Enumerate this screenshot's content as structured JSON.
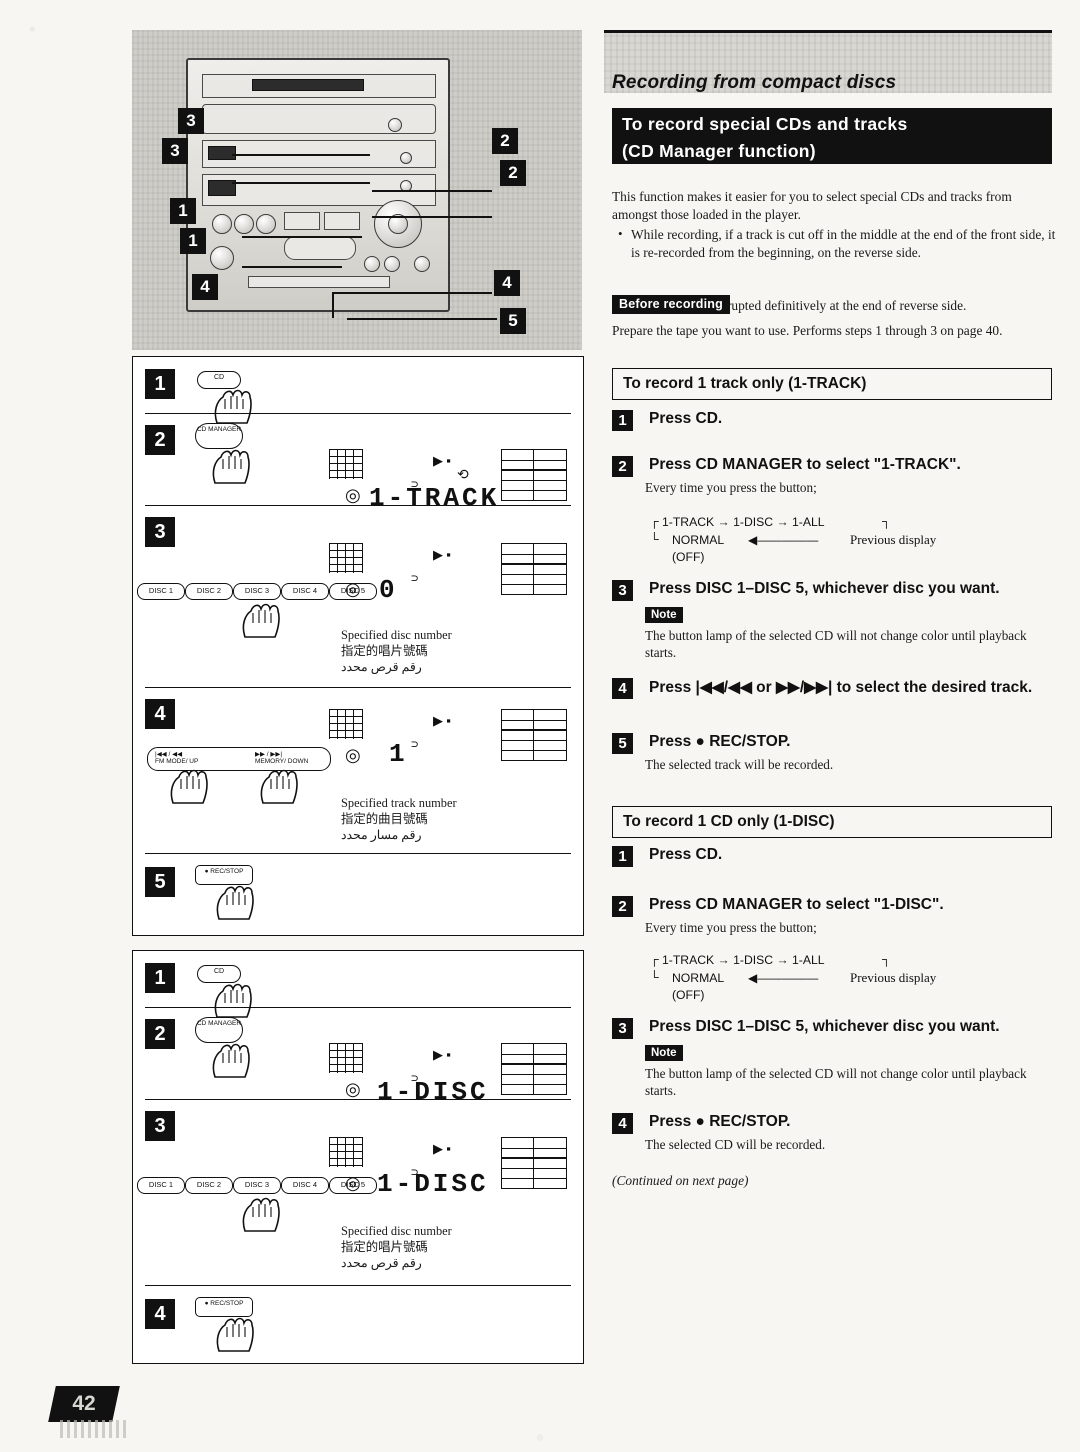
{
  "page": {
    "number": "42",
    "chapter_title": "Recording from compact discs"
  },
  "header": {
    "line1": "To record special CDs and tracks",
    "line2": "(CD Manager function)"
  },
  "intro": {
    "paragraph": "This function makes it easier for you to select special CDs and tracks from amongst those loaded in the player.",
    "bullets": [
      "While recording, if a track is cut off in the middle at the end of the front side, it is re-recorded from the beginning, on the reverse side.",
      "Recording is interrupted definitively at the end of reverse side."
    ]
  },
  "before_recording": {
    "tag": "Before recording",
    "text": "Prepare the tape you want to use. Performs steps 1 through 3 on page 40."
  },
  "sections": [
    {
      "title": "To record 1 track only (1-TRACK)",
      "steps": [
        {
          "num": "1",
          "label": "Press CD.",
          "sub": ""
        },
        {
          "num": "2",
          "label": "Press CD MANAGER to select \"1-TRACK\".",
          "sub": "Every time you press the button;"
        },
        {
          "num": "3",
          "label": "Press DISC 1–DISC 5, whichever disc you want.",
          "note_tag": "Note",
          "sub": "The button lamp of the selected CD will not change color until playback starts."
        },
        {
          "num": "4",
          "label": "Press  |◀◀/◀◀  or  ▶▶/▶▶|  to select the desired track.",
          "sub": ""
        },
        {
          "num": "5",
          "label": "Press ● REC/STOP.",
          "sub": "The selected track will be recorded."
        }
      ],
      "flow": {
        "row1": "1-TRACK  →  1-DISC  →  1-ALL",
        "row2": "NORMAL",
        "row3": "(OFF)",
        "previous": "Previous display"
      }
    },
    {
      "title": "To record 1 CD only (1-DISC)",
      "steps": [
        {
          "num": "1",
          "label": "Press CD.",
          "sub": ""
        },
        {
          "num": "2",
          "label": "Press CD MANAGER to select \"1-DISC\".",
          "sub": "Every time you press the button;"
        },
        {
          "num": "3",
          "label": "Press DISC 1–DISC 5, whichever disc you want.",
          "note_tag": "Note",
          "sub": "The button lamp of the selected CD will not change color until playback starts."
        },
        {
          "num": "4",
          "label": "Press ● REC/STOP.",
          "sub": "The selected CD will be recorded."
        }
      ],
      "flow": {
        "row1": "1-TRACK  →  1-DISC  →  1-ALL",
        "row2": "NORMAL",
        "row3": "(OFF)",
        "previous": "Previous display"
      }
    }
  ],
  "continued": "(Continued on next page)",
  "illustration": {
    "callouts": [
      "3",
      "3",
      "2",
      "2",
      "1",
      "1",
      "4",
      "4",
      "5"
    ],
    "panel_a": {
      "steps": [
        "1",
        "2",
        "3",
        "4",
        "5"
      ],
      "button_labels": {
        "cd": "CD",
        "cd_manager": "CD\nMANAGER",
        "rec_stop": "● REC/STOP",
        "skip_left": "|◀◀ / ◀◀\nFM MODE/ UP",
        "skip_right": "▶▶ / ▶▶|\nMEMORY/ DOWN"
      },
      "disc_buttons": [
        "DISC 1",
        "DISC 2",
        "DISC 3",
        "DISC 4",
        "DISC 5"
      ],
      "display_1": "1-TRACK",
      "display_2": "0",
      "display_3": "1",
      "captions": [
        {
          "en": "Specified disc number",
          "cjk": "指定的唱片號碼",
          "ar": "رقم قرص محدد"
        },
        {
          "en": "Specified track number",
          "cjk": "指定的曲目號碼",
          "ar": "رقم مسار محدد"
        }
      ]
    },
    "panel_b": {
      "steps": [
        "1",
        "2",
        "3",
        "4"
      ],
      "button_labels": {
        "cd": "CD",
        "cd_manager": "CD\nMANAGER",
        "rec_stop": "● REC/STOP"
      },
      "disc_buttons": [
        "DISC 1",
        "DISC 2",
        "DISC 3",
        "DISC 4",
        "DISC 5"
      ],
      "display_1": "1-DISC",
      "display_2": "1-DISC",
      "captions": [
        {
          "en": "Specified disc number",
          "cjk": "指定的唱片號碼",
          "ar": "رقم قرص محدد"
        }
      ]
    }
  }
}
